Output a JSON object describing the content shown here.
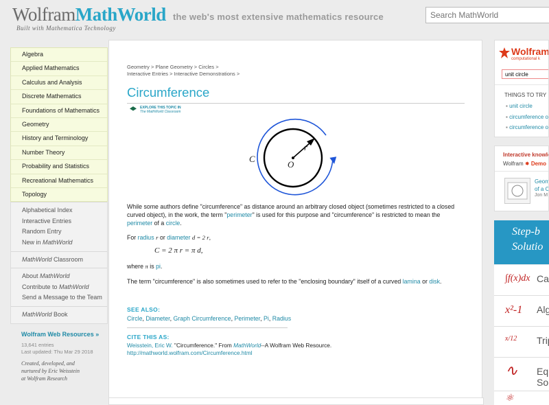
{
  "header": {
    "logo_wolfram": "Wolfram",
    "logo_mathworld": "MathWorld",
    "tagline": "Built with Mathematica Technology",
    "slogan": "the web's most extensive mathematics resource",
    "search_placeholder": "Search MathWorld"
  },
  "nav": {
    "topics": [
      "Algebra",
      "Applied Mathematics",
      "Calculus and Analysis",
      "Discrete Mathematics",
      "Foundations of Mathematics",
      "Geometry",
      "History and Terminology",
      "Number Theory",
      "Probability and Statistics",
      "Recreational Mathematics",
      "Topology"
    ],
    "index_items": [
      "Alphabetical Index",
      "Interactive Entries",
      "Random Entry"
    ],
    "new_in_prefix": "New in ",
    "mathworld": "MathWorld",
    "classroom_suffix": " Classroom",
    "about_prefix": "About ",
    "contribute_prefix": "Contribute to ",
    "send_message": "Send a Message to the Team",
    "book_suffix": " Book",
    "web_resources": "Wolfram Web Resources »",
    "entries": "13,641 entries",
    "updated": "Last updated: Thu Mar 29 2018",
    "credits": [
      "Created, developed, and",
      "nurtured by Eric Weisstein",
      "at Wolfram Research"
    ]
  },
  "content": {
    "breadcrumb_line1": [
      "Geometry",
      "Plane Geometry",
      "Circles"
    ],
    "breadcrumb_line2": [
      "Interactive Entries",
      "Interactive Demonstrations"
    ],
    "title": "Circumference",
    "explore_line1": "EXPLORE THIS TOPIC IN",
    "explore_line2": "The MathWorld Classroom",
    "figure": {
      "label_c": "C",
      "label_r": "r",
      "label_o": "O"
    },
    "p1_a": "While some authors define \"circumference\" as distance around an arbitrary closed object (sometimes restricted to a closed curved object), in the work, the term \"",
    "p1_link1": "perimeter",
    "p1_b": "\" is used for this purpose and \"circumference\" is restricted to mean the ",
    "p1_link2": "perimeter",
    "p1_c": " of a ",
    "p1_link3": "circle",
    "p1_d": ".",
    "p2_for": "For ",
    "p2_radius": "radius",
    "p2_r": "r",
    "p2_or": " or ",
    "p2_diameter": "diameter",
    "p2_eq": "d = 2 r",
    "p2_end": ",",
    "equation": "C = 2 π r = π d,",
    "where_a": "where ",
    "where_pi": "π",
    "where_b": " is ",
    "where_link": "pi",
    "where_c": ".",
    "p3_a": "The term \"circumference\" is also sometimes used to refer to the \"enclosing boundary\" itself of a curved ",
    "p3_link1": "lamina",
    "p3_b": " or ",
    "p3_link2": "disk",
    "p3_c": ".",
    "see_also_label": "SEE ALSO:",
    "see_also": [
      "Circle",
      "Diameter",
      "Graph Circumference",
      "Perimeter",
      "Pi",
      "Radius"
    ],
    "cite_label": "CITE THIS AS:",
    "cite_author": "Weisstein, Eric W.",
    "cite_text_a": " \"Circumference.\" From ",
    "cite_mathworld": "MathWorld",
    "cite_text_b": "--A Wolfram Web Resource.",
    "cite_url": "http://mathworld.wolfram.com/Circumference.html"
  },
  "right": {
    "wa_logo": "Wolfram",
    "wa_sub": "computational k",
    "wa_input": "unit circle",
    "things_to_try": "THINGS TO TRY",
    "try_items": [
      "unit circle",
      "circumference o",
      "circumference o"
    ],
    "interactive": "Interactive knowle",
    "wolfram_demo_a": "Wolfram",
    "wolfram_demo_b": "Demo",
    "demo_title_a": "Geom",
    "demo_title_b": "of a C",
    "demo_author": "Jon M",
    "step_line1": "Step-b",
    "step_line2": "Solutio",
    "subjects": [
      {
        "sym": "∫f(x)dx",
        "label": "Ca"
      },
      {
        "sym": "x²-1",
        "label": "Alg"
      },
      {
        "sym": "x/12",
        "label": "Trip"
      },
      {
        "sym": "∿",
        "label": "Eq"
      },
      {
        "sym": "⚛",
        "label": ""
      }
    ]
  },
  "colors": {
    "accent": "#29a6c8",
    "link": "#1f8aa6",
    "nav_bg": "#f7fbdf",
    "wolfram_red": "#dd3a1a",
    "step_blue": "#2797c4"
  }
}
